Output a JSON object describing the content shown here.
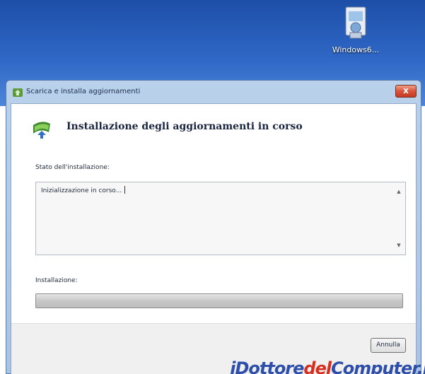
{
  "desktop": {
    "icon_label": "Windows6..."
  },
  "window": {
    "title": "Scarica e installa aggiornamenti",
    "close_glyph": "x",
    "heading": "Installazione degli aggiornamenti in corso",
    "status_label": "Stato dell'installazione:",
    "status_text": "Inizializzazione in corso...",
    "install_label": "Installazione:",
    "progress_percent": 0,
    "cancel_label": "Annulla"
  },
  "watermark": {
    "part1": "iDottore",
    "part2": "del",
    "part3": "Computer.i"
  },
  "colors": {
    "desktop": "#2f67c6",
    "close_button": "#d9533b",
    "watermark_blue": "#2d4ea9",
    "watermark_red": "#d72f1f"
  },
  "icons": {
    "desktop_icon": "installer-package-icon",
    "title_icon": "windows-update-icon",
    "header_icon": "windows-update-icon"
  }
}
